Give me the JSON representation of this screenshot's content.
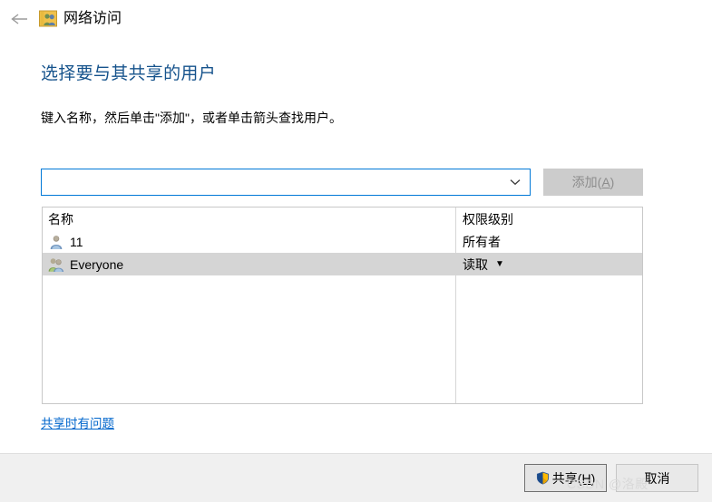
{
  "window": {
    "title": "网络访问",
    "back_icon": "back-arrow-icon",
    "title_icon": "network-sharing-icon"
  },
  "page": {
    "heading": "选择要与其共享的用户",
    "instruction": "键入名称，然后单击\"添加\"，或者单击箭头查找用户。"
  },
  "combo": {
    "value": "",
    "placeholder": "",
    "arrow_icon": "chevron-down-icon"
  },
  "add_button": {
    "label": "添加(A)",
    "enabled": false
  },
  "list": {
    "columns": [
      "名称",
      "权限级别"
    ],
    "rows": [
      {
        "name": "11",
        "permission": "所有者",
        "icon": "single-user-icon",
        "selected": false,
        "has_dropdown": false
      },
      {
        "name": "Everyone",
        "permission": "读取",
        "icon": "group-users-icon",
        "selected": true,
        "has_dropdown": true,
        "caret": "▼"
      }
    ]
  },
  "link": {
    "label": "共享时有问题"
  },
  "footer": {
    "share_label": "共享(H)",
    "share_icon": "uac-shield-icon",
    "cancel_label": "取消"
  },
  "watermark": {
    "text": "CSDN @洛殿"
  },
  "colors": {
    "heading": "#16538c",
    "link": "#0066cc",
    "focus_border": "#0078d7",
    "selection": "#d5d5d5",
    "footer_bg": "#f0f0f0"
  }
}
